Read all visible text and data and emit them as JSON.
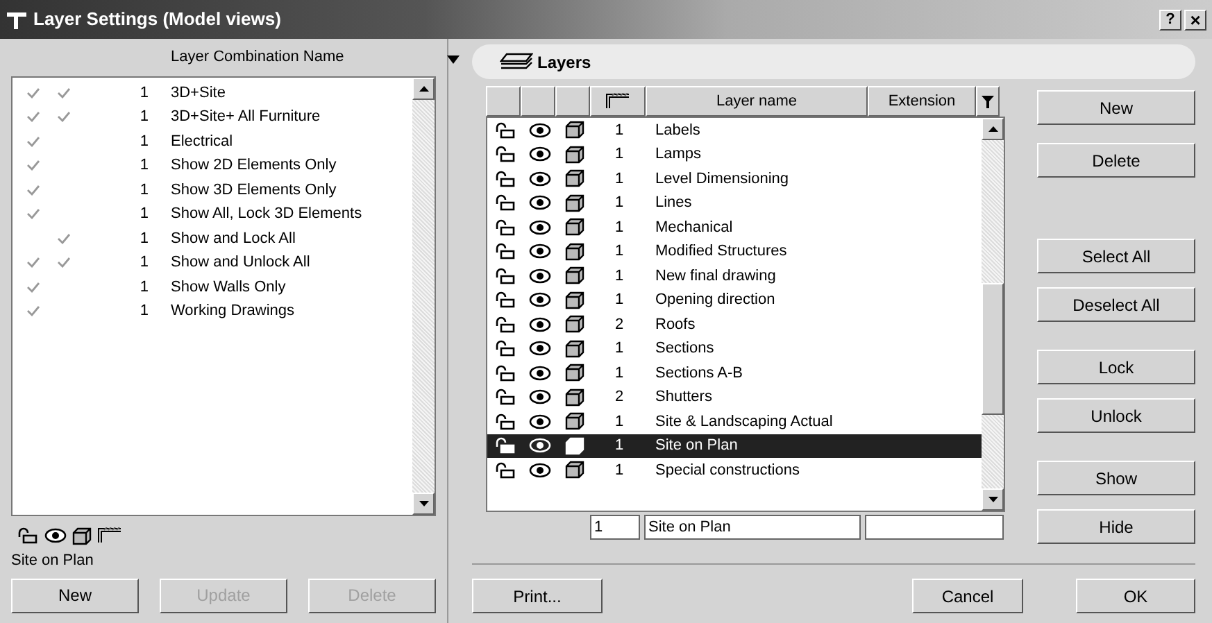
{
  "window": {
    "title": "Layer Settings (Model views)",
    "help": "?",
    "close": "×"
  },
  "combinations": {
    "header": "Layer Combination Name",
    "rows": [
      {
        "check_1": true,
        "check_2": true,
        "count": "1",
        "name": "3D+Site"
      },
      {
        "check_1": true,
        "check_2": true,
        "count": "1",
        "name": "3D+Site+ All Furniture"
      },
      {
        "check_1": true,
        "check_2": false,
        "count": "1",
        "name": "Electrical"
      },
      {
        "check_1": true,
        "check_2": false,
        "count": "1",
        "name": "Show 2D Elements Only"
      },
      {
        "check_1": true,
        "check_2": false,
        "count": "1",
        "name": "Show 3D Elements Only"
      },
      {
        "check_1": true,
        "check_2": false,
        "count": "1",
        "name": "Show All, Lock 3D Elements"
      },
      {
        "check_1": false,
        "check_2": true,
        "count": "1",
        "name": "Show and Lock All"
      },
      {
        "check_1": true,
        "check_2": true,
        "count": "1",
        "name": "Show and Unlock All"
      },
      {
        "check_1": true,
        "check_2": false,
        "count": "1",
        "name": "Show Walls Only"
      },
      {
        "check_1": true,
        "check_2": false,
        "count": "1",
        "name": "Working Drawings"
      }
    ],
    "current": "Site on Plan",
    "buttons": [
      {
        "label": "New",
        "disabled": false
      },
      {
        "label": "Update",
        "disabled": true
      },
      {
        "label": "Delete",
        "disabled": true
      }
    ]
  },
  "layers": {
    "title": "Layers",
    "columns": [
      "Layer name",
      "Extension"
    ],
    "rows": [
      {
        "count": "1",
        "name": "Labels",
        "selected": false
      },
      {
        "count": "1",
        "name": "Lamps",
        "selected": false
      },
      {
        "count": "1",
        "name": "Level Dimensioning",
        "selected": false
      },
      {
        "count": "1",
        "name": "Lines",
        "selected": false
      },
      {
        "count": "1",
        "name": "Mechanical",
        "selected": false
      },
      {
        "count": "1",
        "name": "Modified Structures",
        "selected": false
      },
      {
        "count": "1",
        "name": "New final drawing",
        "selected": false
      },
      {
        "count": "1",
        "name": "Opening direction",
        "selected": false
      },
      {
        "count": "2",
        "name": "Roofs",
        "selected": false
      },
      {
        "count": "1",
        "name": "Sections",
        "selected": false
      },
      {
        "count": "1",
        "name": "Sections A-B",
        "selected": false
      },
      {
        "count": "2",
        "name": "Shutters",
        "selected": false
      },
      {
        "count": "1",
        "name": "Site & Landscaping Actual",
        "selected": false
      },
      {
        "count": "1",
        "name": "Site on Plan",
        "selected": true
      },
      {
        "count": "1",
        "name": "Special constructions",
        "selected": false
      }
    ],
    "edit": {
      "count": "1",
      "name": "Site on Plan"
    },
    "side_buttons": [
      "New",
      "Delete",
      "Select All",
      "Deselect All",
      "Lock",
      "Unlock",
      "Show",
      "Hide"
    ]
  },
  "footer": {
    "print": "Print...",
    "cancel": "Cancel",
    "ok": "OK"
  }
}
